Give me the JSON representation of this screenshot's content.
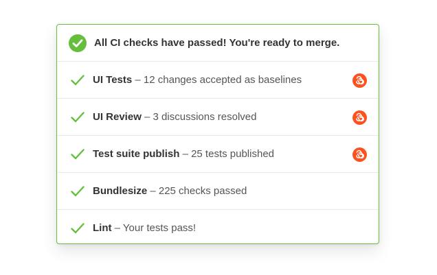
{
  "header": {
    "message": "All CI checks have passed! You're ready to merge.",
    "icon": "check-circle-icon"
  },
  "colors": {
    "success": "#66bf3c",
    "badge": "#fc521f"
  },
  "checks": [
    {
      "name": "UI Tests",
      "detail": " – 12 changes accepted as baselines",
      "badge": "chromatic-icon"
    },
    {
      "name": "UI Review",
      "detail": " – 3 discussions resolved",
      "badge": "chromatic-icon"
    },
    {
      "name": "Test suite publish",
      "detail": " – 25 tests published",
      "badge": "chromatic-icon"
    },
    {
      "name": "Bundlesize",
      "detail": " – 225 checks passed",
      "badge": ""
    },
    {
      "name": "Lint",
      "detail": " – Your tests pass!",
      "badge": ""
    }
  ]
}
